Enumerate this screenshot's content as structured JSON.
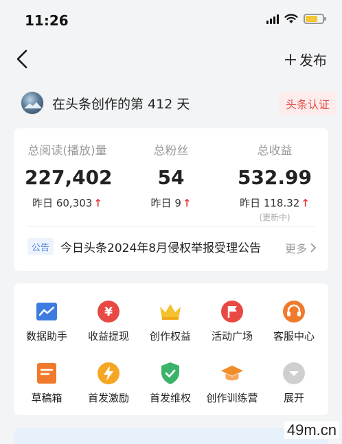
{
  "status_bar": {
    "time": "11:26"
  },
  "nav": {
    "back_icon": "chevron-left-icon",
    "publish_label": "发布"
  },
  "author": {
    "creating_days_text": "在头条创作的第 412 天",
    "cert_badge": "头条认证"
  },
  "stats": [
    {
      "label": "总阅读(播放)量",
      "value": "227,402",
      "yesterday": "昨日 60,303",
      "trend": "up",
      "note": ""
    },
    {
      "label": "总粉丝",
      "value": "54",
      "yesterday": "昨日 9",
      "trend": "up",
      "note": ""
    },
    {
      "label": "总收益",
      "value": "532.99",
      "yesterday": "昨日 118.32",
      "trend": "up",
      "note": "(更新中)"
    }
  ],
  "notice": {
    "tag": "公告",
    "text": "今日头条2024年8月侵权举报受理公告",
    "more": "更多"
  },
  "tools": [
    {
      "label": "数据助手",
      "icon": "chart-icon",
      "color": "#3d7be0"
    },
    {
      "label": "收益提现",
      "icon": "yuan-icon",
      "color": "#e84a43"
    },
    {
      "label": "创作权益",
      "icon": "crown-icon",
      "color": "#f5c12e"
    },
    {
      "label": "活动广场",
      "icon": "flag-icon",
      "color": "#e84a43"
    },
    {
      "label": "客服中心",
      "icon": "headset-icon",
      "color": "#f07a2c"
    },
    {
      "label": "草稿箱",
      "icon": "draft-icon",
      "color": "#f07a2c"
    },
    {
      "label": "首发激励",
      "icon": "lightning-icon",
      "color": "#f5a623"
    },
    {
      "label": "首发维权",
      "icon": "shield-check-icon",
      "color": "#3cb36a"
    },
    {
      "label": "创作训练营",
      "icon": "graduation-cap-icon",
      "color": "#f08c2c"
    },
    {
      "label": "展开",
      "icon": "expand-down-icon",
      "color": "#cfcfcf"
    }
  ],
  "watermark": "49m.cn"
}
